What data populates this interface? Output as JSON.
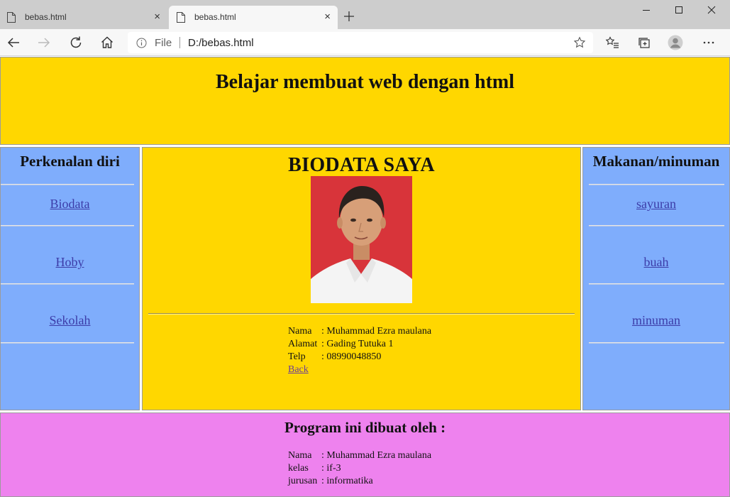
{
  "browser": {
    "tabs": [
      {
        "title": "bebas.html",
        "close": "×"
      },
      {
        "title": "bebas.html",
        "close": "×"
      }
    ],
    "address": {
      "scheme_label": "File",
      "url": "D:/bebas.html"
    },
    "icons": [
      "page-icon",
      "close-icon",
      "plus-icon",
      "minimize-icon",
      "maximize-icon",
      "window-close-icon",
      "back-icon",
      "forward-icon",
      "refresh-icon",
      "home-icon",
      "info-icon",
      "star-icon",
      "favorites-icon",
      "collections-icon",
      "profile-icon",
      "more-icon"
    ]
  },
  "header": {
    "title": "Belajar membuat web dengan html"
  },
  "left_sidebar": {
    "heading": "Perkenalan diri",
    "links": [
      "Biodata",
      "Hoby",
      "Sekolah"
    ]
  },
  "right_sidebar": {
    "heading": "Makanan/minuman",
    "links": [
      "sayuran",
      "buah",
      "minuman"
    ]
  },
  "main": {
    "heading": "BIODATA SAYA",
    "rows": [
      {
        "key": "Nama",
        "value": ": Muhammad Ezra maulana"
      },
      {
        "key": "Alamat",
        "value": ": Gading Tutuka 1"
      },
      {
        "key": "Telp",
        "value": ": 08990048850"
      }
    ],
    "back_link": "Back"
  },
  "footer": {
    "heading": "Program ini dibuat oleh :",
    "rows": [
      {
        "key": "Nama",
        "value": ": Muhammad Ezra maulana"
      },
      {
        "key": "kelas",
        "value": ": if-3"
      },
      {
        "key": "jurusan",
        "value": ": informatika"
      }
    ]
  },
  "colors": {
    "header_bg": "#ffd700",
    "sidebar_bg": "#7fadfc",
    "footer_bg": "#ee82ee",
    "link": "#3c3ca8"
  }
}
